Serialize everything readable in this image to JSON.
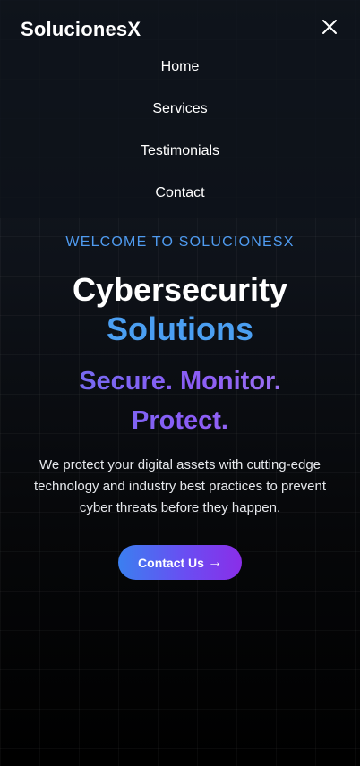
{
  "brand": "SolucionesX",
  "nav": {
    "close_icon": "close-icon",
    "items": [
      {
        "label": "Home"
      },
      {
        "label": "Services"
      },
      {
        "label": "Testimonials"
      },
      {
        "label": "Contact"
      }
    ]
  },
  "hero": {
    "eyebrow": "WELCOME TO SOLUCIONESX",
    "title_line1": "Cybersecurity",
    "title_line2": "Solutions",
    "tagline": "Secure. Monitor. Protect.",
    "description": "We protect your digital assets with cutting-edge technology and industry best practices to prevent cyber threats before they happen.",
    "cta_label": "Contact Us",
    "cta_icon": "→"
  },
  "colors": {
    "accent_blue": "#4b9ff2",
    "accent_purple": "#8b5cf6",
    "cta_gradient_start": "#3b7ff0",
    "cta_gradient_end": "#8a2ee8",
    "background": "#050608"
  }
}
